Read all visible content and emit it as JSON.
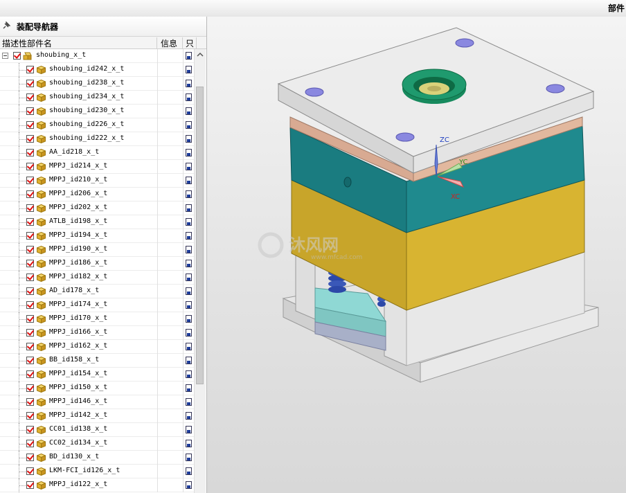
{
  "topbar": {
    "right_title": "部件"
  },
  "navigator": {
    "title": "装配导航器",
    "columns": {
      "name": "描述性部件名",
      "info": "信息",
      "readonly": "只"
    },
    "root": {
      "label": "shoubing_x_t"
    },
    "items": [
      {
        "label": "shoubing_id242_x_t"
      },
      {
        "label": "shoubing_id238_x_t"
      },
      {
        "label": "shoubing_id234_x_t"
      },
      {
        "label": "shoubing_id230_x_t"
      },
      {
        "label": "shoubing_id226_x_t"
      },
      {
        "label": "shoubing_id222_x_t"
      },
      {
        "label": "AA_id218_x_t"
      },
      {
        "label": "MPPJ_id214_x_t"
      },
      {
        "label": "MPPJ_id210_x_t"
      },
      {
        "label": "MPPJ_id206_x_t"
      },
      {
        "label": "MPPJ_id202_x_t"
      },
      {
        "label": "ATLB_id198_x_t"
      },
      {
        "label": "MPPJ_id194_x_t"
      },
      {
        "label": "MPPJ_id190_x_t"
      },
      {
        "label": "MPPJ_id186_x_t"
      },
      {
        "label": "MPPJ_id182_x_t"
      },
      {
        "label": "AD_id178_x_t"
      },
      {
        "label": "MPPJ_id174_x_t"
      },
      {
        "label": "MPPJ_id170_x_t"
      },
      {
        "label": "MPPJ_id166_x_t"
      },
      {
        "label": "MPPJ_id162_x_t"
      },
      {
        "label": "BB_id158_x_t"
      },
      {
        "label": "MPPJ_id154_x_t"
      },
      {
        "label": "MPPJ_id150_x_t"
      },
      {
        "label": "MPPJ_id146_x_t"
      },
      {
        "label": "MPPJ_id142_x_t"
      },
      {
        "label": "CC01_id138_x_t"
      },
      {
        "label": "CC02_id134_x_t"
      },
      {
        "label": "BD_id130_x_t"
      },
      {
        "label": "LKM-FCI_id126_x_t"
      },
      {
        "label": "MPPJ_id122_x_t"
      }
    ]
  },
  "viewport": {
    "axes": {
      "z": "ZC",
      "y": "YC",
      "x": "XC"
    },
    "watermark": "沐风网",
    "watermark_url": "www.mfcad.com"
  },
  "colors": {
    "top_plate": "#ebebeb",
    "teal_plate": "#1f8a8e",
    "yellow_plate": "#d8b431",
    "locating_ring": "#1f9a6e",
    "bolt_holes": "#8a88e0",
    "check_red": "#e01010"
  }
}
